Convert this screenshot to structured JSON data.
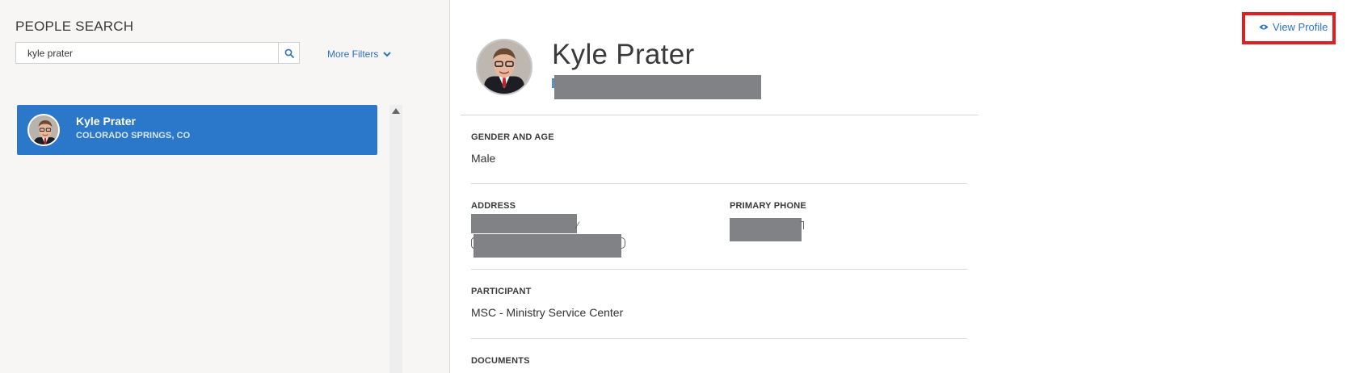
{
  "search_panel": {
    "title": "PEOPLE SEARCH",
    "query": "kyle prater",
    "search_icon": "search-icon",
    "more_filters_label": "More Filters",
    "results": [
      {
        "name": "Kyle Prater",
        "location": "COLORADO SPRINGS, CO"
      }
    ]
  },
  "profile": {
    "view_profile_label": "View Profile",
    "name": "Kyle Prater",
    "gender_age_label": "GENDER AND AGE",
    "gender_age_value": "Male",
    "address_label": "ADDRESS",
    "phone_label": "PRIMARY PHONE",
    "participant_label": "PARTICIPANT",
    "participant_value": "MSC - Ministry Service Center",
    "documents_label": "DOCUMENTS"
  },
  "colors": {
    "accent": "#2b77c9",
    "link": "#2f73c6",
    "highlight_box": "#e02020",
    "redaction": "#808285"
  }
}
